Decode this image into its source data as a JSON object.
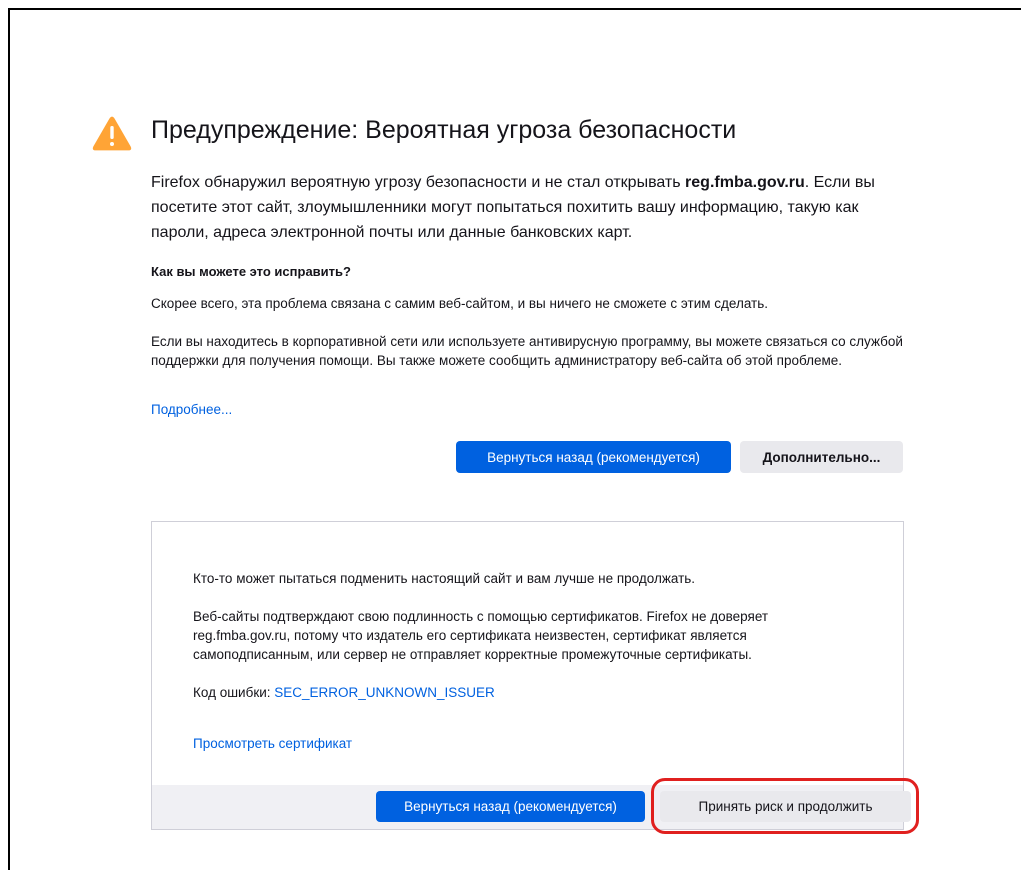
{
  "warning": {
    "title": "Предупреждение: Вероятная угроза безопасности",
    "intro_before": "Firefox обнаружил вероятную угрозу безопасности и не стал открывать ",
    "intro_host": "reg.fmba.gov.ru",
    "intro_after": ". Если вы посетите этот сайт, злоумышленники могут попытаться похитить вашу информацию, такую как пароли, адреса электронной почты или данные банковских карт.",
    "how_to_fix_heading": "Как вы можете это исправить?",
    "how_to_fix_p1": "Скорее всего, эта проблема связана с самим веб-сайтом, и вы ничего не сможете с этим сделать.",
    "how_to_fix_p2": "Если вы находитесь в корпоративной сети или используете антивирусную программу, вы можете связаться со службой поддержки для получения помощи. Вы также можете сообщить администратору веб-сайта об этой проблеме.",
    "learn_more": "Подробнее...",
    "back_button": "Вернуться назад (рекомендуется)",
    "advanced_button": "Дополнительно..."
  },
  "advanced": {
    "text1": "Кто-то может пытаться подменить настоящий сайт и вам лучше не продолжать.",
    "text2": "Веб-сайты подтверждают свою подлинность с помощью сертификатов. Firefox не доверяет reg.fmba.gov.ru, потому что издатель его сертификата неизвестен, сертификат является самоподписанным, или сервер не отправляет корректные промежуточные сертификаты.",
    "error_code_label": "Код ошибки: ",
    "error_code": "SEC_ERROR_UNKNOWN_ISSUER",
    "view_certificate": "Просмотреть сертификат",
    "back_button": "Вернуться назад (рекомендуется)",
    "accept_button": "Принять риск и продолжить"
  },
  "colors": {
    "accent": "#0061e0",
    "warning_icon": "#ffa436",
    "highlight": "#e0201f"
  },
  "icons": {
    "warning": "warning-triangle-icon"
  }
}
